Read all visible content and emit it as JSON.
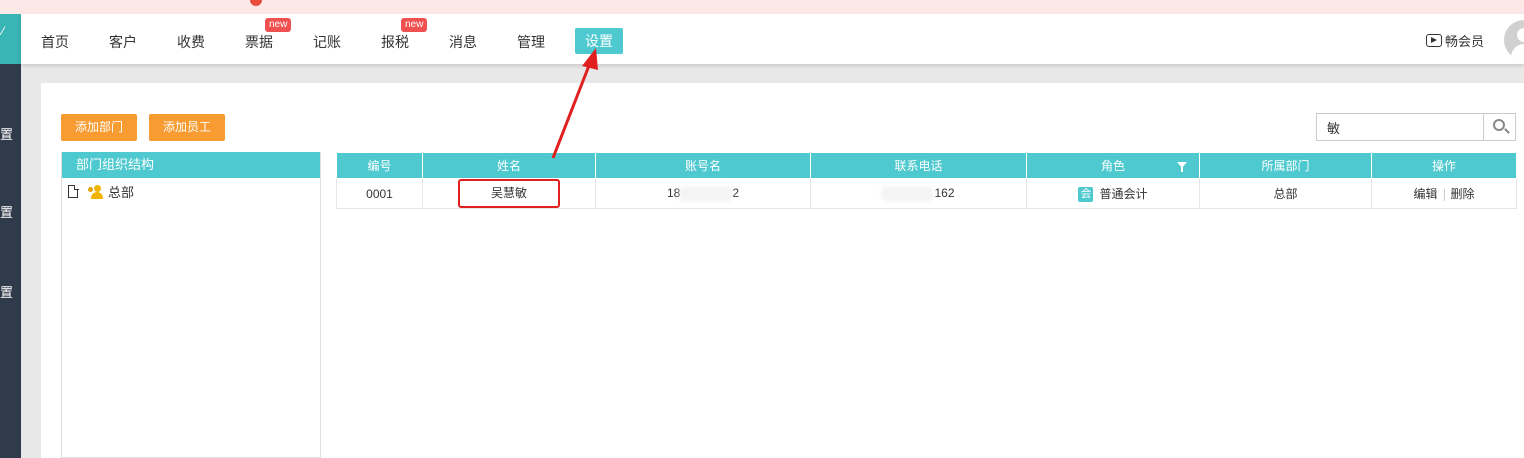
{
  "nav": {
    "items": [
      {
        "label": "首页"
      },
      {
        "label": "客户"
      },
      {
        "label": "收费"
      },
      {
        "label": "票据",
        "badge": "new"
      },
      {
        "label": "记账"
      },
      {
        "label": "报税",
        "badge": "new"
      },
      {
        "label": "消息"
      },
      {
        "label": "管理"
      },
      {
        "label": "设置",
        "active": true
      }
    ],
    "member_label": "畅会员"
  },
  "sidebar": {
    "items": [
      {
        "label": "置"
      },
      {
        "label": "置"
      },
      {
        "label": "置"
      }
    ]
  },
  "toolbar": {
    "add_department_label": "添加部门",
    "add_employee_label": "添加员工"
  },
  "search": {
    "value": "敏"
  },
  "org_panel": {
    "title": "部门组织结构",
    "root_node": "总部"
  },
  "table": {
    "headers": [
      "编号",
      "姓名",
      "账号名",
      "联系电话",
      "角色",
      "所属部门",
      "操作"
    ],
    "rows": [
      {
        "id": "0001",
        "name": "吴慧敏",
        "account_prefix": "18",
        "account_suffix": "2",
        "phone_suffix": "162",
        "role_badge": "会",
        "role": "普通会计",
        "department": "总部",
        "edit_label": "编辑",
        "delete_label": "删除"
      }
    ]
  },
  "colors": {
    "accent": "#4ec9cf",
    "orange": "#f89b30",
    "highlight": "#e02020",
    "badge": "#f05050"
  }
}
